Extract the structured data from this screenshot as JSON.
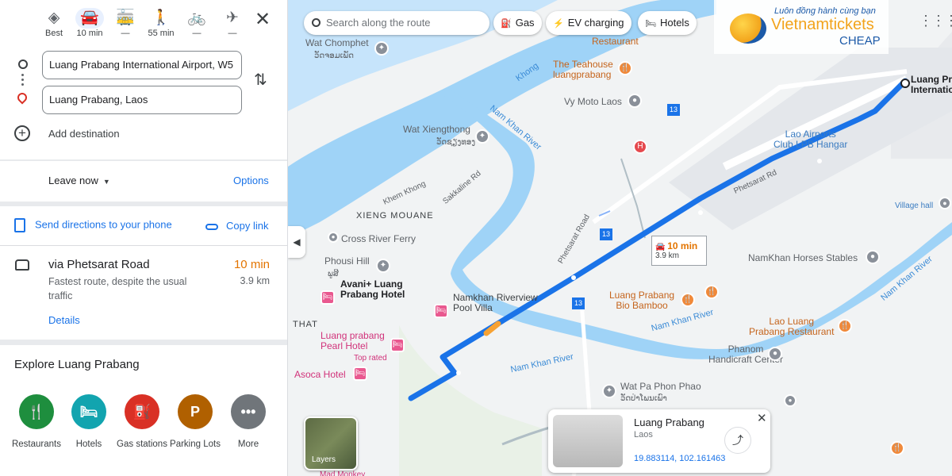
{
  "travel_modes": [
    {
      "label": "Best",
      "icon": "diamond-turn-icon"
    },
    {
      "label": "10 min",
      "icon": "car-icon"
    },
    {
      "label": "—",
      "icon": "transit-icon"
    },
    {
      "label": "55 min",
      "icon": "walk-icon"
    },
    {
      "label": "—",
      "icon": "bicycle-icon"
    },
    {
      "label": "—",
      "icon": "flight-icon"
    }
  ],
  "origin": "Luang Prabang International Airport, W5",
  "destination": "Luang Prabang, Laos",
  "add_destination": "Add destination",
  "leave_now": "Leave now",
  "options": "Options",
  "send_to_phone": "Send directions to your phone",
  "copy_link": "Copy link",
  "route": {
    "via": "via Phetsarat Road",
    "time": "10 min",
    "subtitle": "Fastest route, despite the usual traffic",
    "distance": "3.9 km",
    "details": "Details"
  },
  "explore": {
    "title": "Explore Luang Prabang",
    "categories": [
      {
        "label": "Restaurants",
        "color": "#1e8e3e",
        "icon": "fork-knife-icon"
      },
      {
        "label": "Hotels",
        "color": "#12a4af",
        "icon": "bed-icon"
      },
      {
        "label": "Gas stations",
        "color": "#d93025",
        "icon": "gas-pump-icon"
      },
      {
        "label": "Parking Lots",
        "color": "#b06000",
        "icon": "parking-icon"
      },
      {
        "label": "More",
        "color": "#70757a",
        "icon": "more-icon"
      }
    ]
  },
  "map": {
    "search_placeholder": "Search along the route",
    "chips": [
      "Gas",
      "EV charging",
      "Hotels"
    ],
    "logo_top": "Luôn đồng hành cùng bạn",
    "logo_mid": "Vietnamtickets",
    "logo_bottom": "CHEAP",
    "route_popup": {
      "time": "10 min",
      "distance": "3.9 km"
    },
    "layers_label": "Layers",
    "labels": {
      "wat_chomphet": "Wat Chomphet",
      "wat_chomphet_lao": "ວັດຈອມເພັດ",
      "restaurant_top": "Restaurant",
      "teahouse": "The Teahouse\nluangprabang",
      "vy_moto": "Vy Moto Laos",
      "khong": "Khong",
      "nam_khan_1": "Nam Khan River",
      "wat_xiengthong": "Wat Xiengthong",
      "wat_xiengthong_lao": "ວັດຊຽງທອງ",
      "sakkaline": "Sakkaline Rd",
      "khem_khong": "Khem Khong",
      "xieng_mouane": "XIENG MOUANE",
      "cross_river": "Cross River Ferry",
      "phousi": "Phousi Hill",
      "phousi_lao": "ພູສີ",
      "avani": "Avani+ Luang\nPrabang Hotel",
      "namkhan_villa": "Namkhan Riverview\nPool Villa",
      "that": "THAT",
      "pearl": "Luang prabang\nPearl Hotel",
      "top_rated": "Top rated",
      "asoca": "Asoca Hotel",
      "phetsarat_road": "Phetsarat Road",
      "phetsarat_rd": "Phetsarat Rd",
      "lao_airports": "Lao Airports\nClub LPB Hangar",
      "airport": "Luang Pra\nInternatio",
      "village_hall": "Village hall",
      "namkhan_horses": "NamKhan Horses Stables",
      "bio_bamboo": "Luang Prabang\nBio Bamboo",
      "nam_khan_2": "Nam Khan River",
      "nam_khan_3": "Nam Khan River",
      "nam_khan_4": "Nam Khan River",
      "lao_luang": "Lao Luang\nPrabang Restaurant",
      "phanom": "Phanom\nHandicraft Center",
      "wat_pa_phon": "Wat Pa Phon Phao",
      "wat_pa_phon_lao": "ວັດປ່າໂພນເພົາ",
      "route_13a": "13",
      "route_13b": "13",
      "route_13c": "13",
      "bottom_cut": "Mad Monkey"
    }
  },
  "place_card": {
    "name": "Luang Prabang",
    "country": "Laos",
    "coords": "19.883114, 102.161463"
  }
}
